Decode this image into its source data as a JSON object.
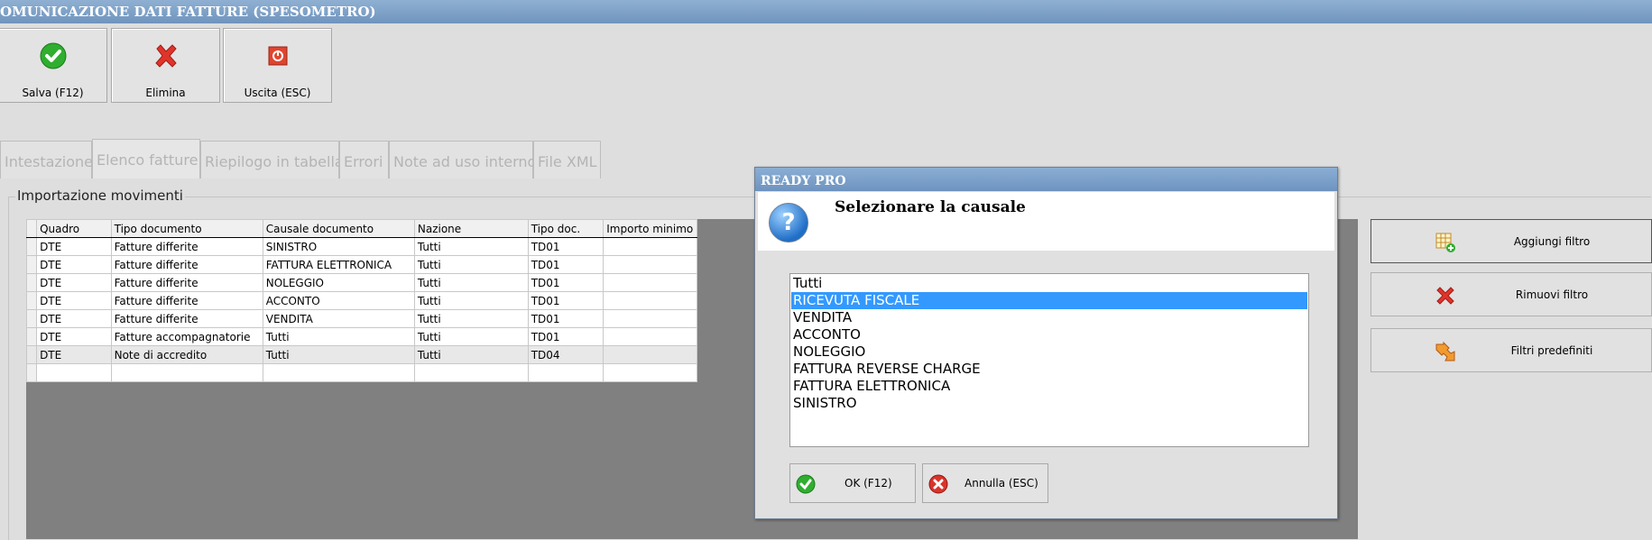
{
  "window": {
    "title": "OMUNICAZIONE DATI FATTURE (SPESOMETRO)"
  },
  "toolbar": {
    "save_label": "Salva (F12)",
    "delete_label": "Elimina",
    "exit_label": "Uscita (ESC)"
  },
  "tabs": [
    {
      "label": "Intestazione"
    },
    {
      "label": "Elenco fatture"
    },
    {
      "label": "Riepilogo in tabella"
    },
    {
      "label": "Errori"
    },
    {
      "label": "Note ad uso interno"
    },
    {
      "label": "File XML"
    }
  ],
  "group": {
    "legend": "Importazione movimenti"
  },
  "grid": {
    "columns": [
      "Quadro",
      "Tipo documento",
      "Causale documento",
      "Nazione",
      "Tipo doc.",
      "Importo minimo"
    ],
    "rows": [
      [
        "DTE",
        "Fatture differite",
        "SINISTRO",
        "Tutti",
        "TD01",
        ""
      ],
      [
        "DTE",
        "Fatture differite",
        "FATTURA ELETTRONICA",
        "Tutti",
        "TD01",
        ""
      ],
      [
        "DTE",
        "Fatture differite",
        "NOLEGGIO",
        "Tutti",
        "TD01",
        ""
      ],
      [
        "DTE",
        "Fatture differite",
        "ACCONTO",
        "Tutti",
        "TD01",
        ""
      ],
      [
        "DTE",
        "Fatture differite",
        "VENDITA",
        "Tutti",
        "TD01",
        ""
      ],
      [
        "DTE",
        "Fatture accompagnatorie",
        "Tutti",
        "Tutti",
        "TD01",
        ""
      ],
      [
        "DTE",
        "Note di accredito",
        "Tutti",
        "Tutti",
        "TD04",
        ""
      ]
    ]
  },
  "side_buttons": {
    "add_filter": "Aggiungi filtro",
    "remove_filter": "Rimuovi filtro",
    "preset_filters": "Filtri predefiniti"
  },
  "dialog": {
    "title": "READY PRO",
    "message": "Selezionare la causale",
    "items": [
      "Tutti",
      "RICEVUTA FISCALE",
      "VENDITA",
      "ACCONTO",
      "NOLEGGIO",
      "FATTURA REVERSE CHARGE",
      "FATTURA ELETTRONICA",
      "SINISTRO"
    ],
    "selected_index": 1,
    "ok_label": "OK (F12)",
    "cancel_label": "Annulla (ESC)"
  },
  "colors": {
    "title_bar": "#7fa3c9",
    "selection": "#3399ff",
    "grid_background": "#808080"
  }
}
